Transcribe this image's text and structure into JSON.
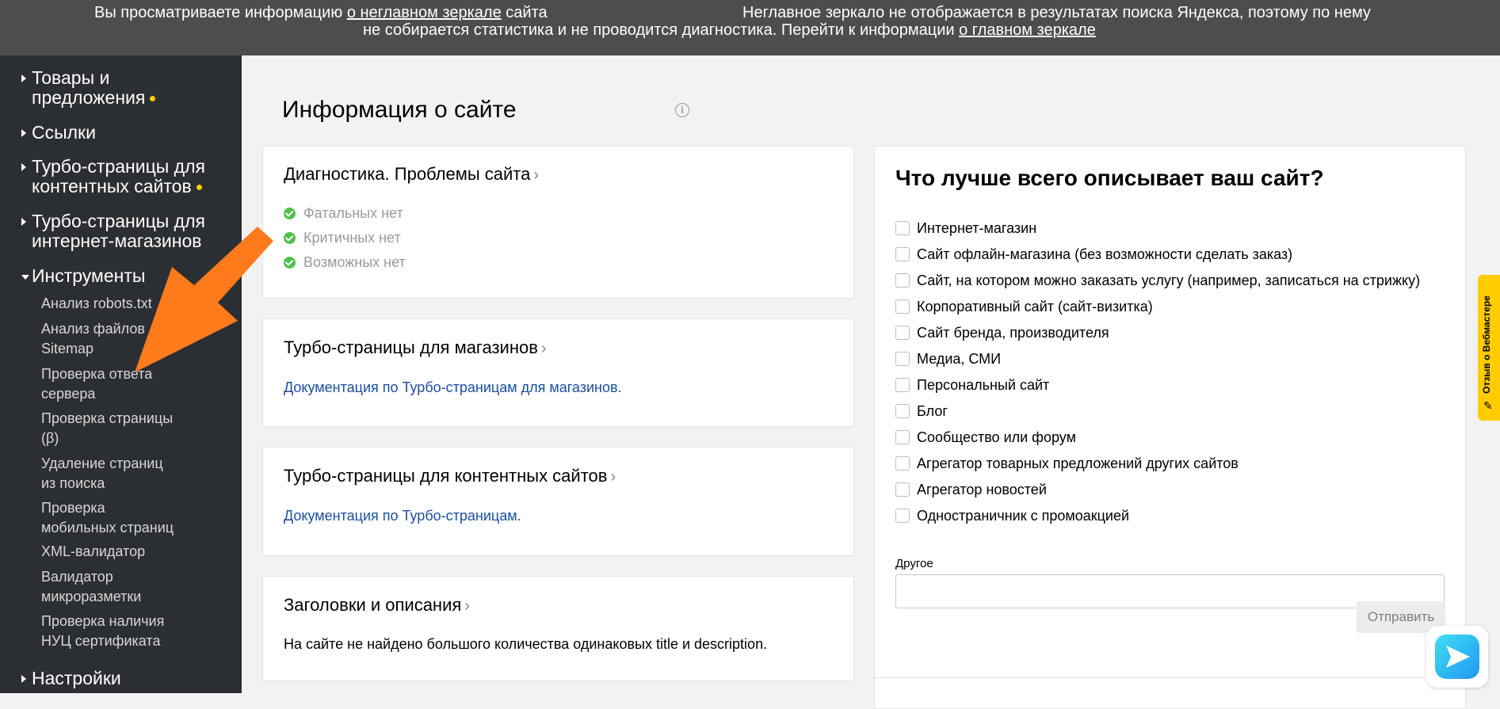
{
  "banner": {
    "line1_prefix": "Вы просматриваете информацию ",
    "line1_link": "о неглавном зеркале",
    "line1_suffix": " сайта",
    "line1_right": "Неглавное зеркало не отображается в результатах поиска Яндекса, поэтому по нему",
    "line2_text": "не собирается статистика и не проводится диагностика. Перейти к информации ",
    "line2_link": "о главном зеркале"
  },
  "sidebar": {
    "top_items": [
      {
        "label_line1": "Товары и",
        "label_line2": "предложения"
      },
      {
        "label_line1": "Ссылки"
      },
      {
        "label_line1": "Турбо-страницы для",
        "label_line2": "контентных сайтов"
      },
      {
        "label_line1": "Турбо-страницы для",
        "label_line2": "интернет-магазинов"
      },
      {
        "label_line1": "Инструменты"
      }
    ],
    "tools": [
      {
        "line1": "Анализ robots.txt"
      },
      {
        "line1": "Анализ файлов",
        "line2": "Sitemap"
      },
      {
        "line1": "Проверка ответа",
        "line2": "сервера"
      },
      {
        "line1": "Проверка страницы",
        "line2": "(β)"
      },
      {
        "line1": "Удаление страниц",
        "line2": "из поиска"
      },
      {
        "line1": "Проверка",
        "line2": "мобильных страниц"
      },
      {
        "line1": "XML-валидатор"
      },
      {
        "line1": "Валидатор",
        "line2": "микроразметки"
      },
      {
        "line1": "Проверка наличия",
        "line2": "НУЦ сертификата"
      }
    ],
    "settings": "Настройки"
  },
  "page": {
    "title": "Информация о сайте",
    "info_icon": "i"
  },
  "cards": {
    "diagnostics": {
      "title": "Диагностика. Проблемы сайта",
      "items": [
        "Фатальных нет",
        "Критичных нет",
        "Возможных нет"
      ]
    },
    "turbo_shops": {
      "title": "Турбо-страницы для магазинов",
      "link": "Документация по Турбо-страницам для магазинов."
    },
    "turbo_content": {
      "title": "Турбо-страницы для контентных сайтов",
      "link": "Документация по Турбо-страницам."
    },
    "headers": {
      "title": "Заголовки и описания",
      "text": "На сайте не найдено большого количества одинаковых title и description."
    }
  },
  "survey": {
    "title": "Что лучше всего описывает ваш сайт?",
    "options": [
      "Интернет-магазин",
      "Сайт офлайн-магазина (без возможности сделать заказ)",
      "Сайт, на котором можно заказать услугу (например, записаться на стрижку)",
      "Корпоративный сайт (сайт-визитка)",
      "Сайт бренда, производителя",
      "Медиа, СМИ",
      "Персональный сайт",
      "Блог",
      "Сообщество или форум",
      "Агрегатор товарных предложений других сайтов",
      "Агрегатор новостей",
      "Одностраничник с промоакцией"
    ],
    "other_label": "Другое",
    "submit": "Отправить"
  },
  "feedback_tab": "Отзыв о Вебмастере",
  "colors": {
    "banner_bg": "#4d4d4d",
    "sidebar_bg": "#2b2f33",
    "accent_dot": "#ffcc00",
    "link": "#1a4ea1",
    "ok_green": "#4fc14a",
    "annotation_arrow": "#ff7a1a"
  },
  "icons": [
    "chevron-right-icon",
    "check-circle-icon",
    "info-icon",
    "chat-icon",
    "feedback-icon"
  ]
}
